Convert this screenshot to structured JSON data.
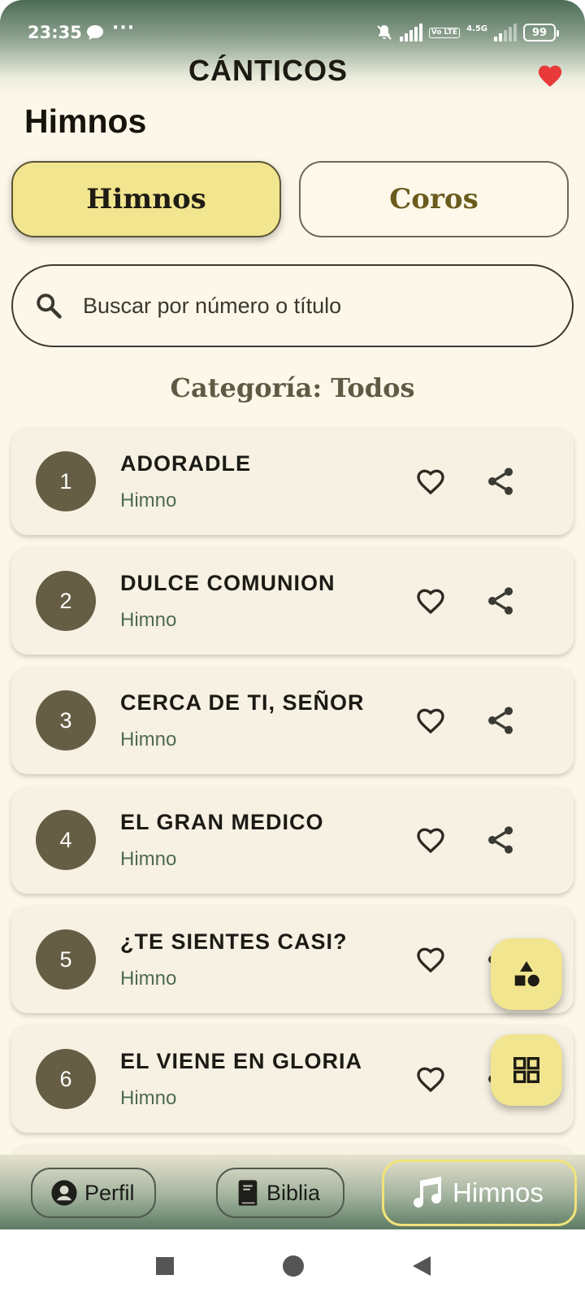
{
  "status_bar": {
    "time": "23:35",
    "dots": "···",
    "network": "4.5G",
    "volte": "Vo LTE",
    "battery": "99"
  },
  "header": {
    "title": "CÁNTICOS"
  },
  "page": {
    "heading": "Himnos"
  },
  "tabs": [
    {
      "label": "Himnos",
      "active": true
    },
    {
      "label": "Coros",
      "active": false
    }
  ],
  "search": {
    "placeholder": "Buscar por número o título",
    "value": ""
  },
  "category": {
    "text": "Categoría: Todos"
  },
  "songs": [
    {
      "number": "1",
      "title": "ADORADLE",
      "type": "Himno"
    },
    {
      "number": "2",
      "title": "DULCE COMUNION",
      "type": "Himno"
    },
    {
      "number": "3",
      "title": "CERCA DE TI, SEÑOR",
      "type": "Himno"
    },
    {
      "number": "4",
      "title": "EL GRAN MEDICO",
      "type": "Himno"
    },
    {
      "number": "5",
      "title": "¿TE SIENTES CASI?",
      "type": "Himno"
    },
    {
      "number": "6",
      "title": "EL VIENE EN GLORIA",
      "type": "Himno"
    }
  ],
  "bottom_nav": [
    {
      "label": "Perfil",
      "icon": "person-icon"
    },
    {
      "label": "Biblia",
      "icon": "book-icon"
    },
    {
      "label": "Himnos",
      "icon": "music-note-icon",
      "active": true
    }
  ],
  "colors": {
    "accent_yellow": "#f2e58f",
    "background": "#fcf7e9",
    "card": "#f7f1e3",
    "number_badge": "#665e44",
    "header_green": "#4d6c55",
    "favorite_red": "#e83a3a"
  }
}
